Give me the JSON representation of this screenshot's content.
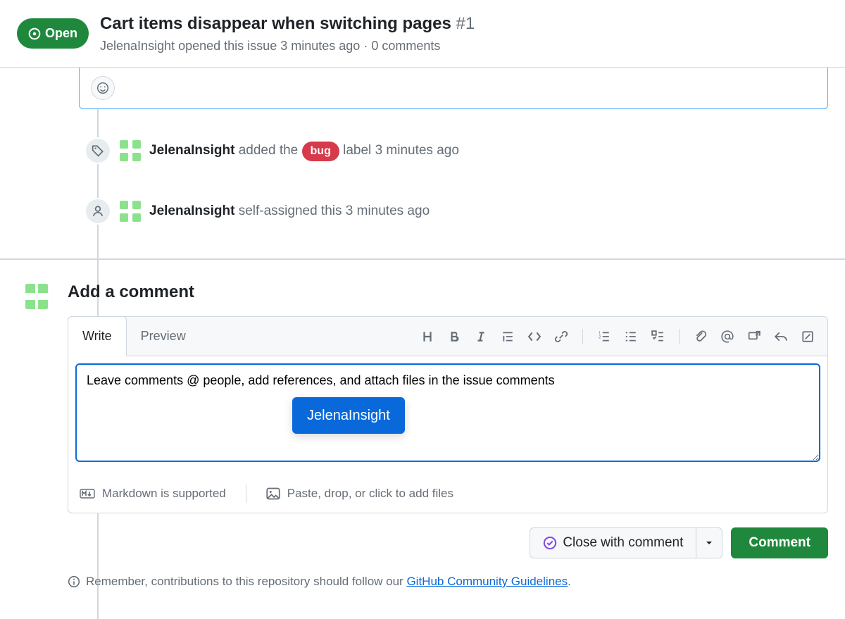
{
  "header": {
    "state": "Open",
    "title": "Cart items disappear when switching pages",
    "issue_number": "#1",
    "author": "JelenaInsight",
    "opened_text": "opened this issue",
    "time": "3 minutes ago",
    "separator": "·",
    "comments": "0 comments"
  },
  "timeline": {
    "label_event": {
      "author": "JelenaInsight",
      "action_before": "added the",
      "label": "bug",
      "action_after": "label",
      "time": "3 minutes ago"
    },
    "assign_event": {
      "author": "JelenaInsight",
      "action": "self-assigned this",
      "time": "3 minutes ago"
    }
  },
  "comment_form": {
    "heading": "Add a comment",
    "tabs": {
      "write": "Write",
      "preview": "Preview"
    },
    "textarea_value": "Leave comments @ people, add references, and attach files in the issue comments",
    "mention_suggestion": "JelenaInsight",
    "footer": {
      "markdown": "Markdown is supported",
      "attach": "Paste, drop, or click to add files"
    },
    "buttons": {
      "close": "Close with comment",
      "submit": "Comment"
    }
  },
  "guidelines": {
    "prefix": "Remember, contributions to this repository should follow our ",
    "link": "GitHub Community Guidelines",
    "suffix": "."
  },
  "colors": {
    "accent": "#0969da",
    "open": "#1f883d",
    "bug": "#d73a4a"
  }
}
